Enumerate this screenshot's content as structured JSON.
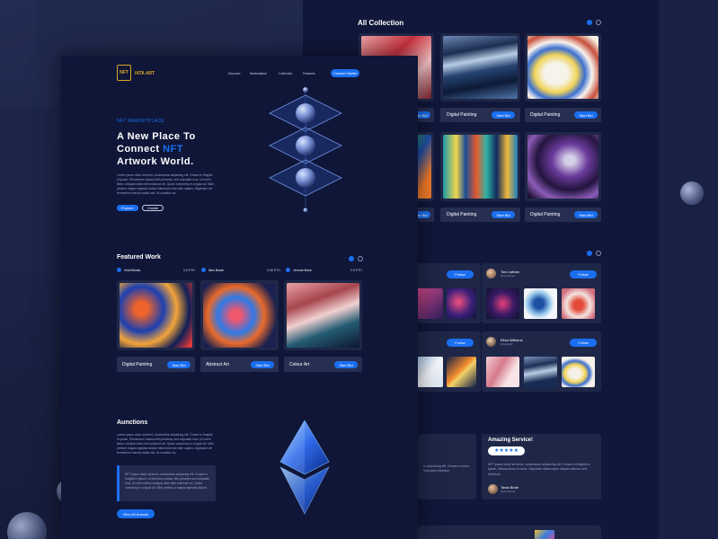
{
  "nav": {
    "logo_text": "NFT",
    "brand": "IATA ART",
    "links": [
      "Discover",
      "Marketplace",
      "Collection",
      "Features"
    ],
    "contact_label": "Contact Wallet"
  },
  "hero": {
    "eyebrow": "NFT MARKETPLACE",
    "title_line1": "A New Place To",
    "title_line2_prefix": "Connect",
    "title_line2_accent": "NFT",
    "title_line3": "Artwork World.",
    "body": "Lorem ipsum dolor sit amet, consectetur adipiscing elit. Ornare in fringilla in ipsum. Elementum massa nibh pharetra, sed vulputate mus. Ut lorem libero volutpat vitae nibh euismod vel. Quam nonummy in a ligula sit. Nibh pretium magna egestas dictum bibendum nisl vitae sapien. Dignissim vel fermentum mauris mattis nisl. Ut curabitur ac.",
    "explore_label": "Explore",
    "create_label": "Create"
  },
  "all_collection": {
    "title": "All Collection",
    "cards": [
      {
        "label": "",
        "button": "Start Bid"
      },
      {
        "label": "Digital Painting",
        "button": "Start Bid"
      },
      {
        "label": "Digital Painting",
        "button": "Start Bid"
      },
      {
        "label": "",
        "button": "Start Bid"
      },
      {
        "label": "Digital Painting",
        "button": "Start Bid"
      },
      {
        "label": "Digital Painting",
        "button": "Start Bid"
      }
    ]
  },
  "featured": {
    "title": "Featured Work",
    "creators": [
      {
        "name": "Vivid Books",
        "price": "0.5 ETH"
      },
      {
        "name": "Alex Bonte",
        "price": "0.05 ETH"
      },
      {
        "name": "Jerome Bone",
        "price": "0.5 ETH"
      }
    ],
    "cards": [
      {
        "label": "Digital Painting",
        "button": "Start Bid"
      },
      {
        "label": "Abstract Art",
        "button": "Start Bid"
      },
      {
        "label": "Colour Art",
        "button": "Start Bid"
      }
    ]
  },
  "artists": {
    "follow_label": "Follow",
    "items": [
      {
        "name": "Tom Lathan",
        "sub": "@tomlathan"
      },
      {
        "name": "Eliza Williams",
        "sub": "@elizawill"
      }
    ]
  },
  "auctions": {
    "title": "Aunctions",
    "body": "Lorem ipsum dolor sit amet, consectetur adipiscing elit. Ornare in fringilla in ipsum. Elementum massa nibh pharetra, sed vulputate mus. Ut lorem libero volutpat vitae nibh euismod vel. Quam nonummy in a ligula sit. Nibh pretium magna egestas dictum bibendum nisl vitae sapien. Dignissim vel fermentum mauris mattis nisl. Ut curabitur ac.",
    "quote": "NFT ipsum dolor sit amet, consectetur adipiscing elit. Ornare in fringilla in ipsum. Ut interdum massa nibh pharetra sed vulputate mus. Ut lorem libero volutpat vitae nibh euismod vel. Quam nonummy in a ligula sit. Nibh pretium a magna egestas dictum.",
    "button": "View All Artwork"
  },
  "reviews": {
    "title": "Amazing Service!",
    "stars": "★★★★★",
    "body": "NFT ipsum dolor sit amet, consectetur adipiscing elit. Ornare in fringilla in ipsum. Massa lacus in tortor. Vulputate ullamcorper aliquet ultricies sed interdum.",
    "body_left": "ur adipiscing elit. Ornare in tortor. Vulputate interdum.",
    "author": "Tania Bride",
    "author_sub": "@taniabride"
  },
  "colors": {
    "accent": "#1a6ff0",
    "panel": "#0f1638",
    "card": "#1f2748"
  }
}
